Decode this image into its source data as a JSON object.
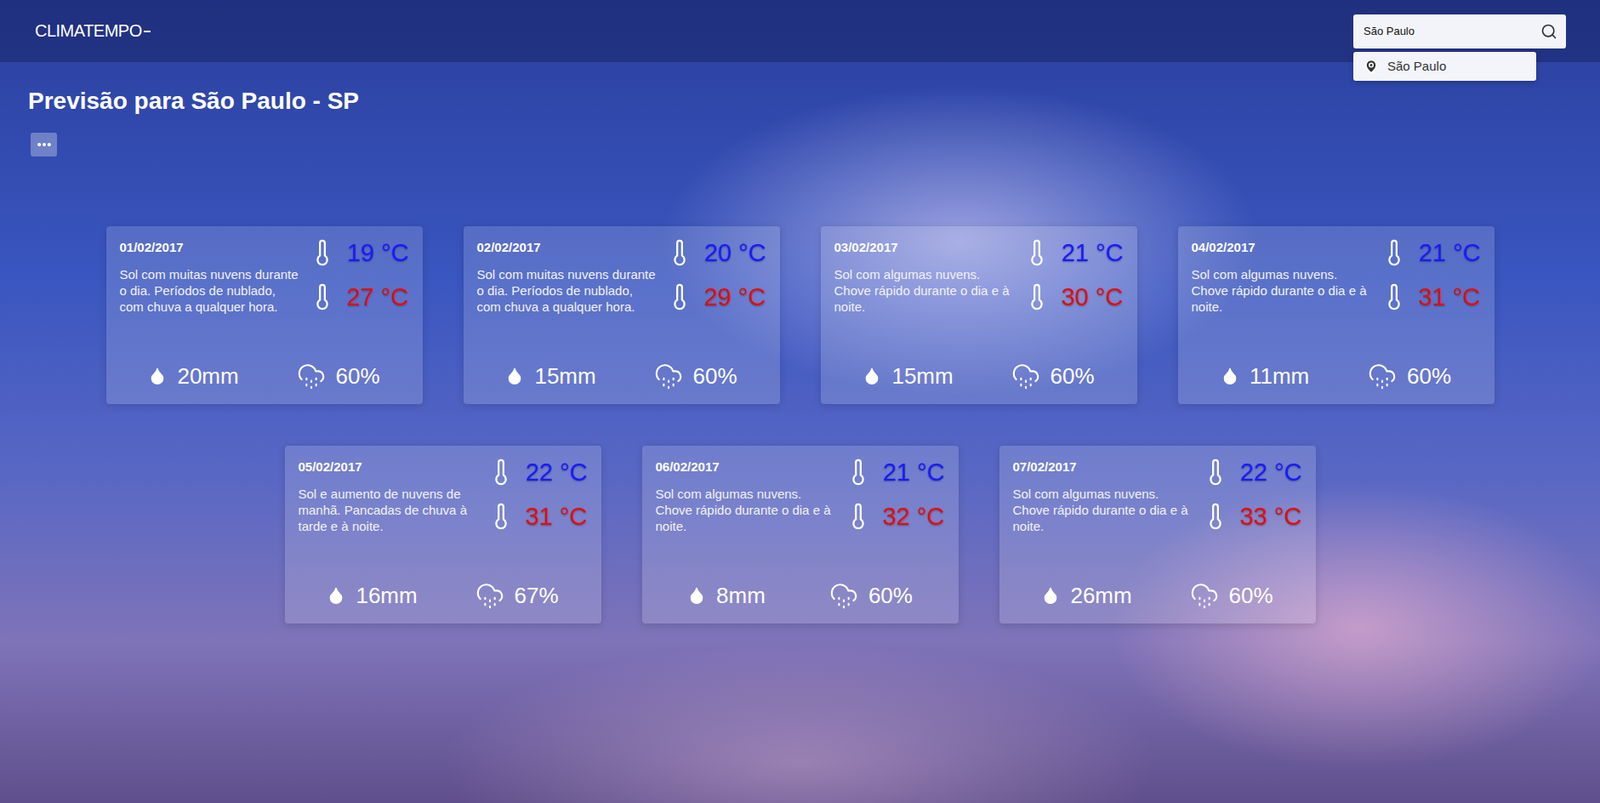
{
  "header": {
    "logo": "CLIMATEMPO",
    "search": {
      "value": "São Paulo"
    },
    "suggestions": [
      {
        "label": "São Paulo",
        "selected": false
      }
    ]
  },
  "title": "Previsão para São Paulo - SP",
  "forecasts": [
    {
      "date": "01/02/2017",
      "description": "Sol com muitas nuvens durante o dia. Períodos de nublado, com chuva a qualquer hora.",
      "min": "19 °C",
      "max": "27 °C",
      "rain": "20mm",
      "probability": "60%"
    },
    {
      "date": "02/02/2017",
      "description": "Sol com muitas nuvens durante o dia. Períodos de nublado, com chuva a qualquer hora.",
      "min": "20 °C",
      "max": "29 °C",
      "rain": "15mm",
      "probability": "60%"
    },
    {
      "date": "03/02/2017",
      "description": "Sol com algumas nuvens. Chove rápido durante o dia e à noite.",
      "min": "21 °C",
      "max": "30 °C",
      "rain": "15mm",
      "probability": "60%"
    },
    {
      "date": "04/02/2017",
      "description": "Sol com algumas nuvens. Chove rápido durante o dia e à noite.",
      "min": "21 °C",
      "max": "31 °C",
      "rain": "11mm",
      "probability": "60%"
    },
    {
      "date": "05/02/2017",
      "description": "Sol e aumento de nuvens de manhã. Pancadas de chuva à tarde e à noite.",
      "min": "22 °C",
      "max": "31 °C",
      "rain": "16mm",
      "probability": "67%"
    },
    {
      "date": "06/02/2017",
      "description": "Sol com algumas nuvens. Chove rápido durante o dia e à noite.",
      "min": "21 °C",
      "max": "32 °C",
      "rain": "8mm",
      "probability": "60%"
    },
    {
      "date": "07/02/2017",
      "description": "Sol com algumas nuvens. Chove rápido durante o dia e à noite.",
      "min": "22 °C",
      "max": "33 °C",
      "rain": "26mm",
      "probability": "60%"
    }
  ]
}
